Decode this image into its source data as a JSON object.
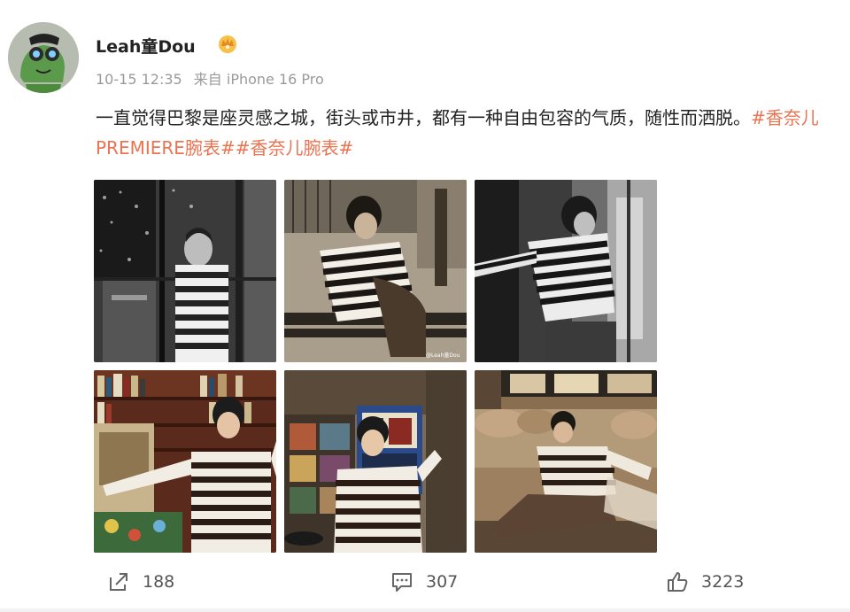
{
  "post": {
    "user_name": "Leah童Dou",
    "timestamp": "10-15 12:35",
    "source": "来自 iPhone 16 Pro",
    "text_main": "一直觉得巴黎是座灵感之城，街头或市井，都有一种自由包容的气质，随性而洒脱。",
    "hashtags": [
      "#香奈儿PREMIERE腕表#",
      "#香奈儿腕表#"
    ],
    "photo_watermark": "@Leah童Dou"
  },
  "actions": {
    "share_count": "188",
    "comment_count": "307",
    "like_count": "3223"
  },
  "icons": {
    "badge": "crown-badge-icon",
    "share": "share-icon",
    "comment": "comment-icon",
    "like": "thumbs-up-icon"
  },
  "colors": {
    "hashtag": "#eb7350",
    "meta": "#9a9a9a"
  }
}
